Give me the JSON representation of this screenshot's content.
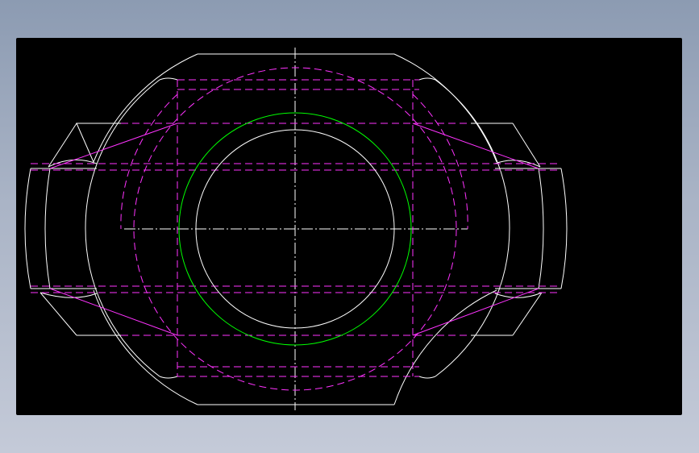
{
  "viewport": {
    "background": "#000000",
    "line_colors": {
      "outline": "#ffffff",
      "hidden": "#ff33ff",
      "circle": "#00ff00",
      "centerline": "#ffffff"
    }
  },
  "drawing": {
    "content": "cad-part-top-view",
    "annotations": []
  }
}
